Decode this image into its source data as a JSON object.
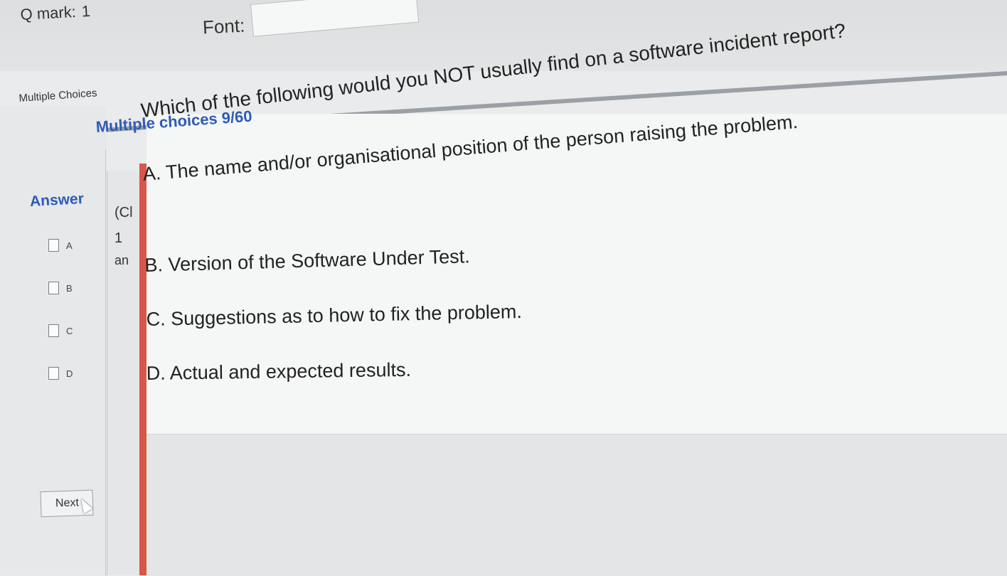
{
  "header": {
    "qmark_label": "Q mark:",
    "qmark_value": "1",
    "font_label": "Font:",
    "font_value": ""
  },
  "tab": {
    "label": "Multiple Choices"
  },
  "panel": {
    "title": "Multiple choices 9/60",
    "clipped_text": [
      "(Cl",
      "1",
      "an"
    ]
  },
  "question": {
    "text": "Which of the following would you NOT usually find on a software incident report?",
    "options": [
      "A. The name and/or organisational position of the person raising the problem.",
      "B. Version of the Software Under Test.",
      "C. Suggestions as to how to fix the problem.",
      "D. Actual and expected results."
    ]
  },
  "answer": {
    "label": "Answer",
    "options": [
      "A",
      "B",
      "C",
      "D"
    ]
  },
  "buttons": {
    "next_label": "Next"
  },
  "colors": {
    "accent_blue": "#2f5bb7",
    "red_bar": "#d8574a"
  },
  "icons": {
    "cursor": "mouse-pointer-icon",
    "dropdown": "chevron-down-icon"
  }
}
